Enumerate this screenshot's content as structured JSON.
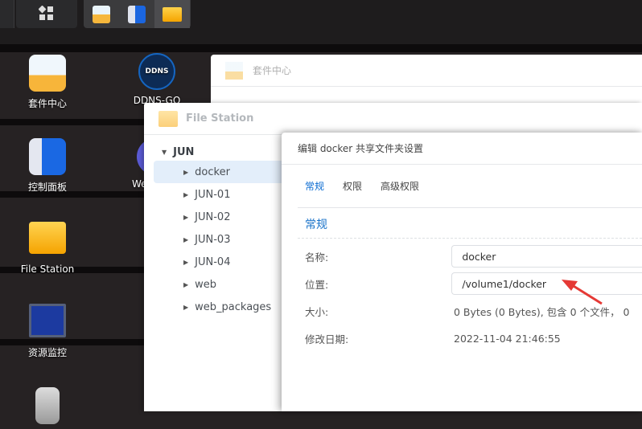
{
  "taskbar": {
    "apps": [
      "package-center",
      "control-panel",
      "file-station"
    ]
  },
  "desktop": {
    "icons": [
      {
        "label": "套件中心"
      },
      {
        "label": "DDNS-GO",
        "logo_text": "DDNS"
      },
      {
        "label": "控制面板"
      },
      {
        "label": "We"
      },
      {
        "label": "File Station"
      },
      {
        "label": "资源监控"
      }
    ]
  },
  "package_center": {
    "title": "套件中心"
  },
  "file_station": {
    "title": "File Station",
    "tree": {
      "root": "JUN",
      "items": [
        "docker",
        "JUN-01",
        "JUN-02",
        "JUN-03",
        "JUN-04",
        "web",
        "web_packages"
      ],
      "selected": "docker"
    }
  },
  "dialog": {
    "title": "编辑 docker 共享文件夹设置",
    "tabs": [
      "常规",
      "权限",
      "高级权限"
    ],
    "section": "常规",
    "fields": {
      "name_label": "名称:",
      "name_value": "docker",
      "location_label": "位置:",
      "location_value": "/volume1/docker",
      "size_label": "大小:",
      "size_value": "0 Bytes (0 Bytes), 包含 0 个文件， 0",
      "modified_label": "修改日期:",
      "modified_value": "2022-11-04 21:46:55"
    }
  },
  "colors": {
    "accent": "#0b6bd1",
    "arrow": "#e53935"
  }
}
